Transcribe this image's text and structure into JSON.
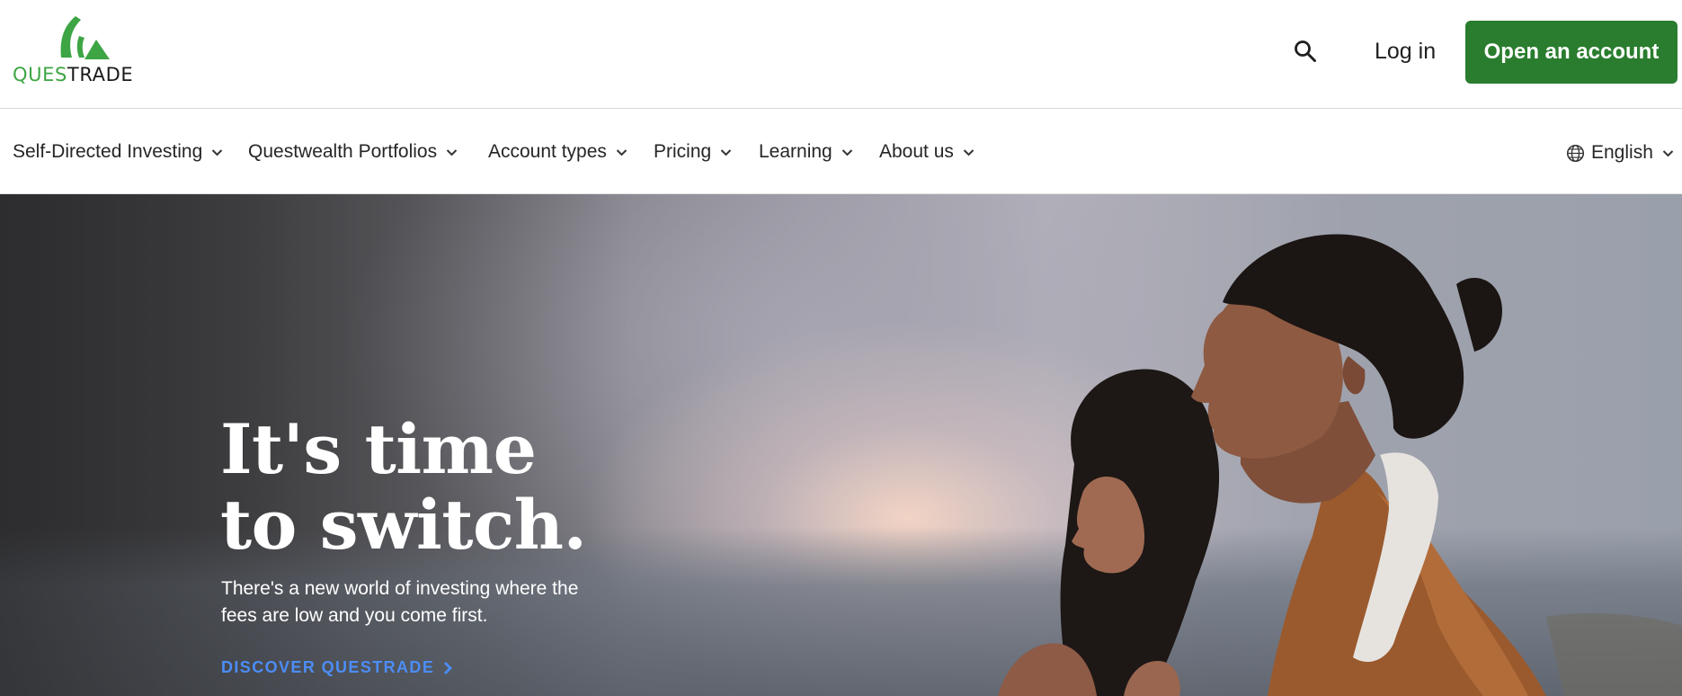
{
  "brand": {
    "logo_part1": "QUES",
    "logo_part2": "TRADE",
    "colors": {
      "green": "#3da544",
      "button_green": "#2a7d2e",
      "cta_blue": "#4c8df6"
    }
  },
  "header": {
    "search_icon": "search-icon",
    "login_label": "Log in",
    "open_account_label": "Open an account"
  },
  "nav": {
    "items": [
      {
        "label": "Self-Directed Investing"
      },
      {
        "label": "Questwealth Portfolios"
      },
      {
        "label": "Account types"
      },
      {
        "label": "Pricing"
      },
      {
        "label": "Learning"
      },
      {
        "label": "About us"
      }
    ],
    "language": {
      "label": "English",
      "icon": "globe-icon"
    }
  },
  "hero": {
    "title_line1": "It's time",
    "title_line2": "to switch.",
    "subtitle": "There's a new world of investing where the fees are low and you come first.",
    "cta_label": "DISCOVER QUESTRADE"
  }
}
